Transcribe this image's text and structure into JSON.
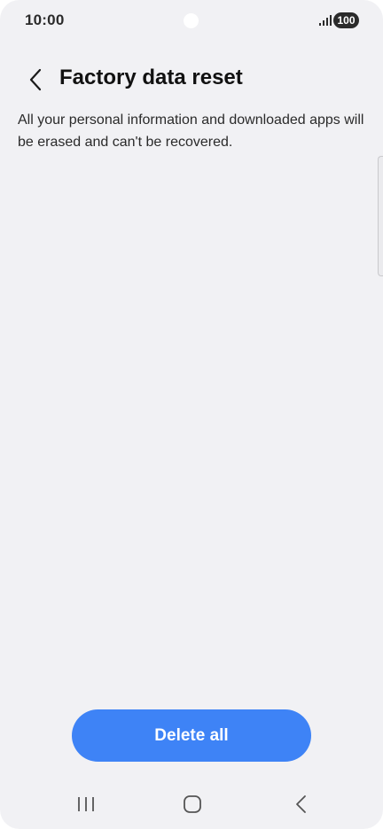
{
  "status_bar": {
    "time": "10:00",
    "battery": "100"
  },
  "header": {
    "title": "Factory data reset",
    "back_icon": "chevron-left-icon"
  },
  "content": {
    "description": "All your personal information and downloaded apps will be erased and can't be recovered."
  },
  "actions": {
    "delete_label": "Delete all"
  },
  "nav_bar": {
    "recents_icon": "recents-icon",
    "home_icon": "home-icon",
    "back_icon": "back-icon"
  },
  "colors": {
    "background": "#f1f1f4",
    "accent": "#3e83f6",
    "text": "#111111"
  }
}
